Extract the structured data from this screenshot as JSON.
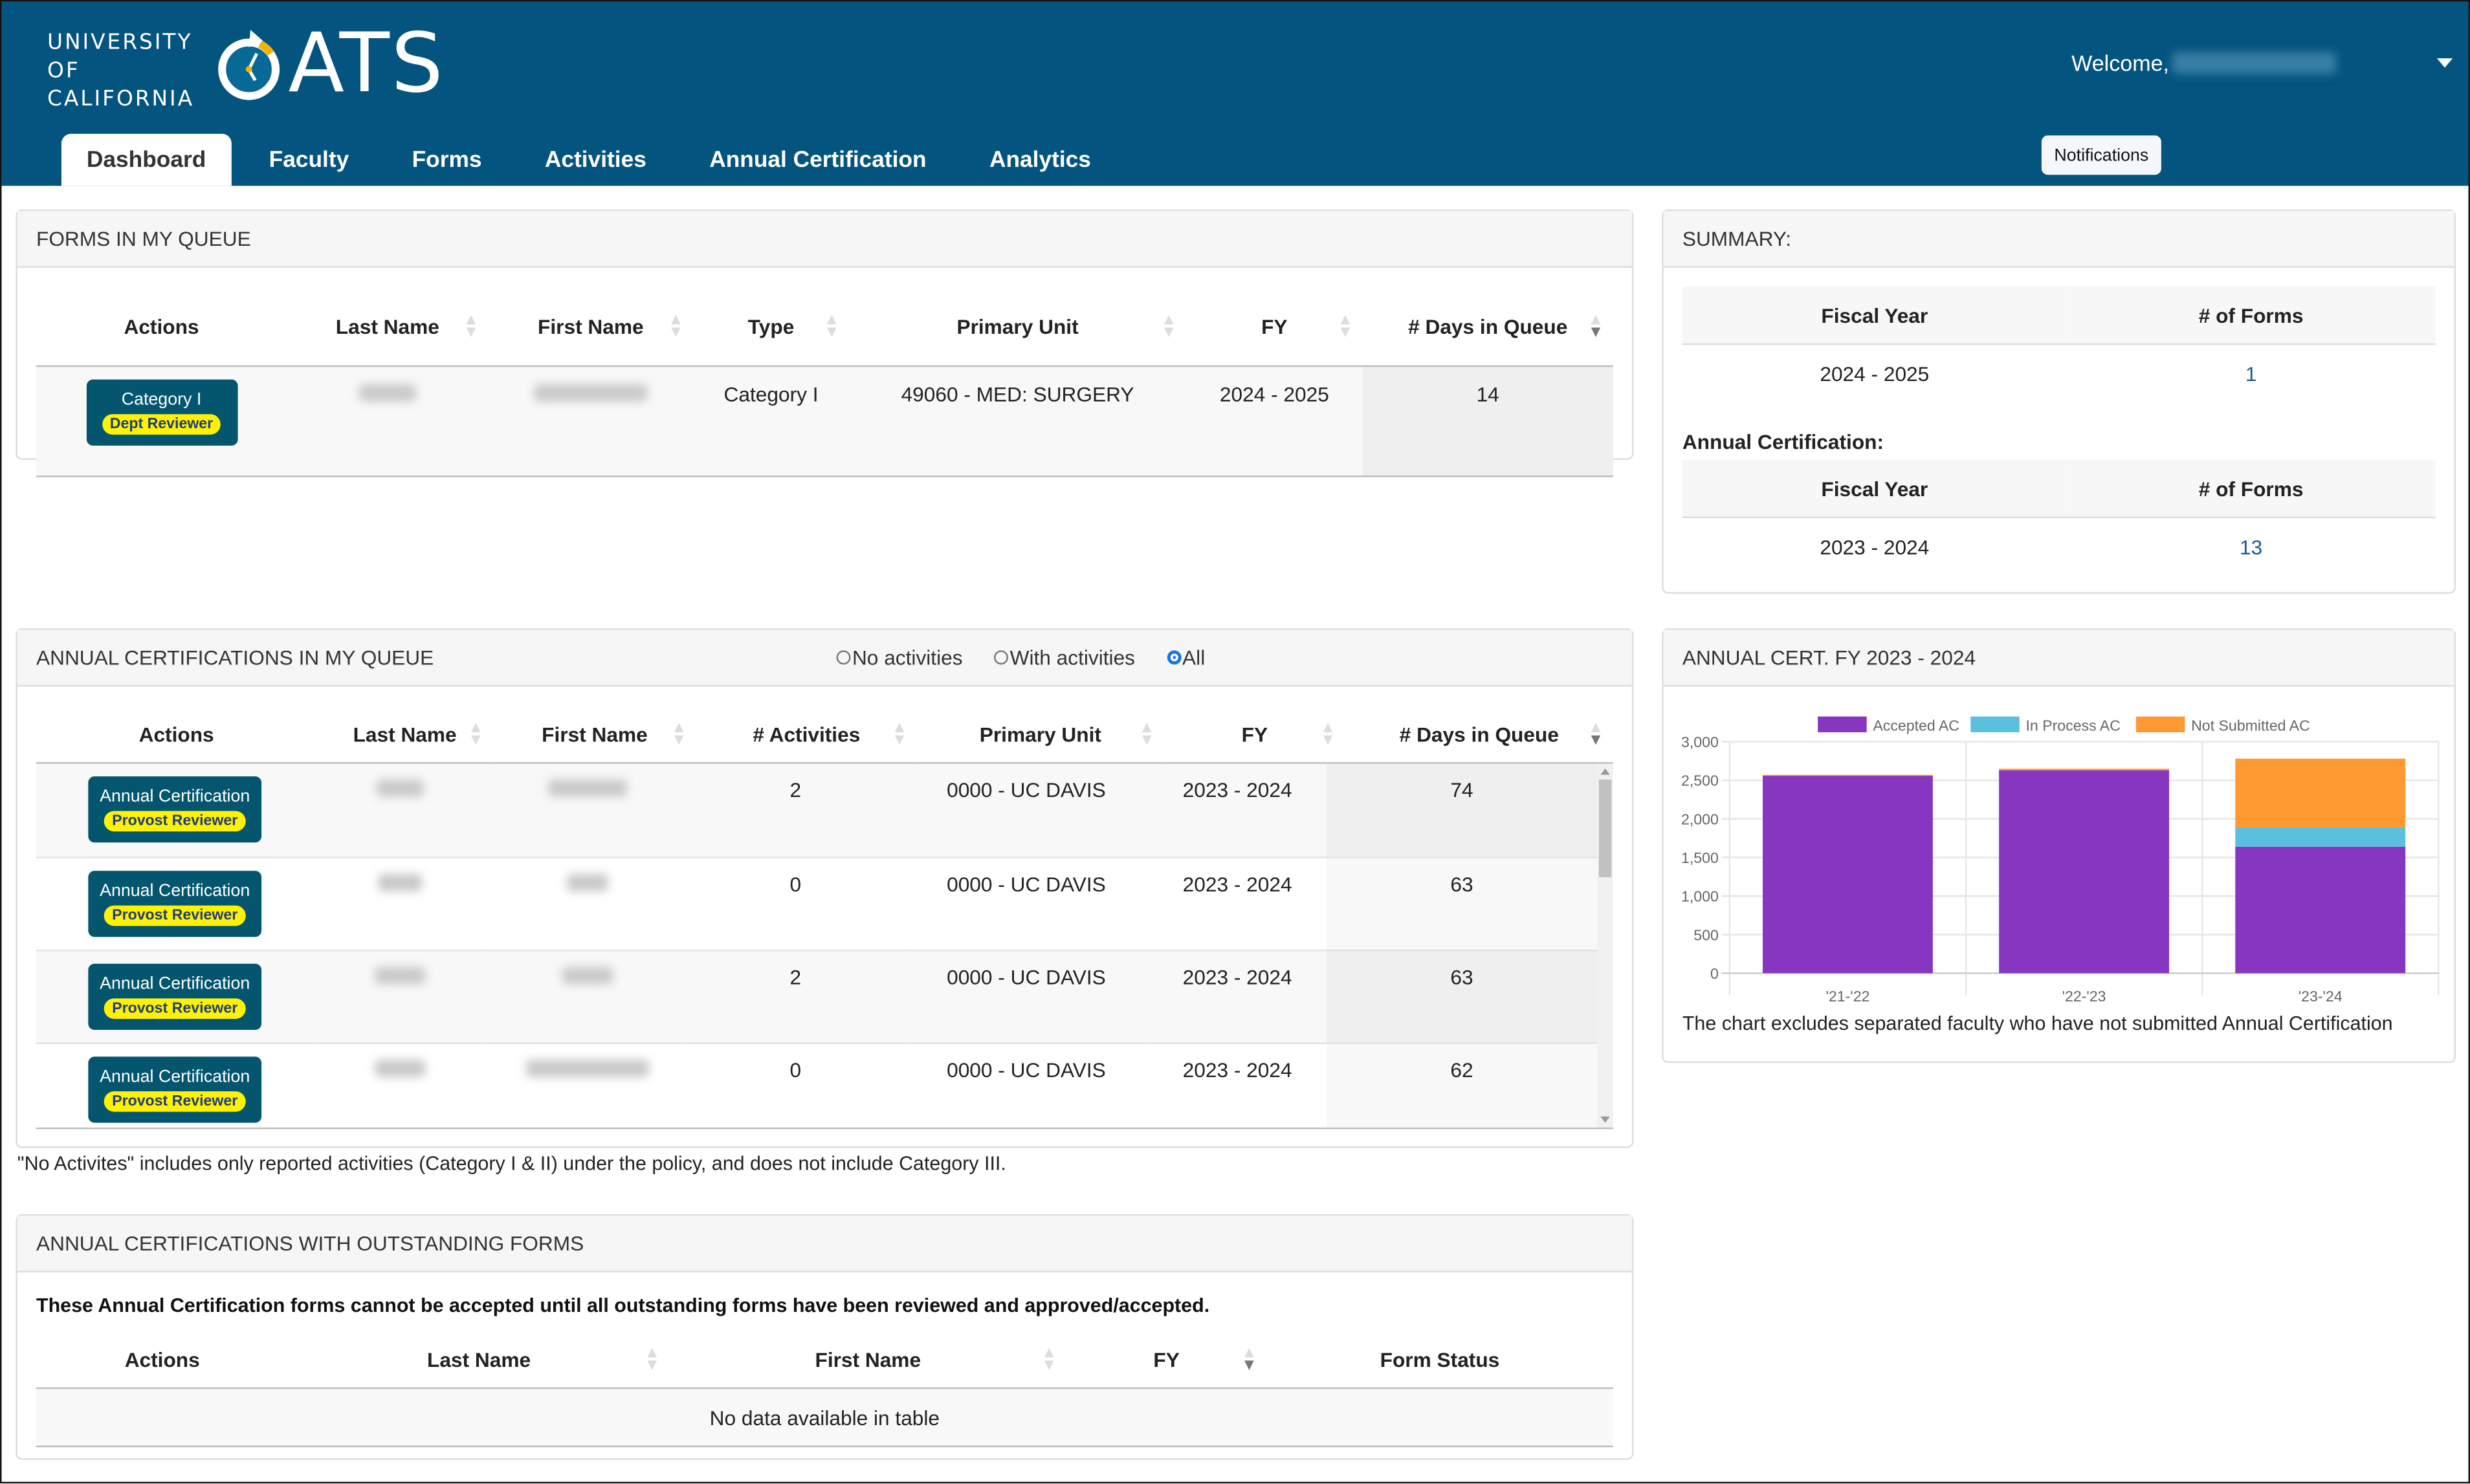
{
  "header": {
    "org_lines": [
      "UNIVERSITY",
      "OF",
      "CALIFORNIA"
    ],
    "app_name": "ATS",
    "app_logo_icon": "clock-o-icon",
    "welcome_label": "Welcome,",
    "user_menu_icon": "caret-down-icon",
    "notifications_label": "Notifications",
    "tabs": [
      {
        "label": "Dashboard",
        "active": true
      },
      {
        "label": "Faculty",
        "active": false
      },
      {
        "label": "Forms",
        "active": false
      },
      {
        "label": "Activities",
        "active": false
      },
      {
        "label": "Annual Certification",
        "active": false
      },
      {
        "label": "Analytics",
        "active": false
      }
    ]
  },
  "forms_queue": {
    "title": "FORMS IN MY QUEUE",
    "columns": [
      "Actions",
      "Last Name",
      "First Name",
      "Type",
      "Primary Unit",
      "FY",
      "# Days in Queue"
    ],
    "rows": [
      {
        "action_label": "Category I",
        "action_badge": "Dept Reviewer",
        "last_name": "[redacted]",
        "first_name": "[redacted]",
        "type": "Category I",
        "primary_unit": "49060 - MED: SURGERY",
        "fy": "2024 - 2025",
        "days": "14"
      }
    ]
  },
  "summary": {
    "title": "SUMMARY:",
    "forms_table": {
      "columns": [
        "Fiscal Year",
        "# of Forms"
      ],
      "rows": [
        {
          "fy": "2024 - 2025",
          "count": "1"
        }
      ]
    },
    "ac_label": "Annual Certification:",
    "ac_table": {
      "columns": [
        "Fiscal Year",
        "# of Forms"
      ],
      "rows": [
        {
          "fy": "2023 - 2024",
          "count": "13"
        }
      ]
    }
  },
  "ac_queue": {
    "title": "ANNUAL CERTIFICATIONS IN MY QUEUE",
    "filters": [
      {
        "label": "No activities",
        "checked": false
      },
      {
        "label": "With activities",
        "checked": false
      },
      {
        "label": "All",
        "checked": true
      }
    ],
    "columns": [
      "Actions",
      "Last Name",
      "First Name",
      "# Activities",
      "Primary Unit",
      "FY",
      "# Days in Queue"
    ],
    "rows": [
      {
        "action_label": "Annual Certification",
        "action_badge": "Provost Reviewer",
        "last_name": "[redacted]",
        "first_name": "[redacted]",
        "activities": "2",
        "primary_unit": "0000 - UC DAVIS",
        "fy": "2023 - 2024",
        "days": "74"
      },
      {
        "action_label": "Annual Certification",
        "action_badge": "Provost Reviewer",
        "last_name": "[redacted]",
        "first_name": "[redacted]",
        "activities": "0",
        "primary_unit": "0000 - UC DAVIS",
        "fy": "2023 - 2024",
        "days": "63"
      },
      {
        "action_label": "Annual Certification",
        "action_badge": "Provost Reviewer",
        "last_name": "[redacted]",
        "first_name": "[redacted]",
        "activities": "2",
        "primary_unit": "0000 - UC DAVIS",
        "fy": "2023 - 2024",
        "days": "63"
      },
      {
        "action_label": "Annual Certification",
        "action_badge": "Provost Reviewer",
        "last_name": "[redacted]",
        "first_name": "[redacted]",
        "activities": "0",
        "primary_unit": "0000 - UC DAVIS",
        "fy": "2023 - 2024",
        "days": "62"
      }
    ],
    "footnote": "\"No Activites\" includes only reported activities (Category I & II) under the policy, and does not include Category III."
  },
  "outstanding": {
    "title": "ANNUAL CERTIFICATIONS WITH OUTSTANDING FORMS",
    "description": "These Annual Certification forms cannot be accepted until all outstanding forms have been reviewed and approved/accepted.",
    "columns": [
      "Actions",
      "Last Name",
      "First Name",
      "FY",
      "Form Status"
    ],
    "empty_message": "No data available in table"
  },
  "chart_panel": {
    "title": "ANNUAL CERT. FY 2023 - 2024",
    "note": "The chart excludes separated faculty who have not submitted Annual Certification"
  },
  "chart_data": {
    "type": "bar",
    "stacked": true,
    "title": "",
    "xlabel": "",
    "ylabel": "",
    "categories": [
      "'21-'22",
      "'22-'23",
      "'23-'24"
    ],
    "series": [
      {
        "name": "Accepted AC",
        "color": "#8736c2",
        "values": [
          2560,
          2630,
          1640
        ]
      },
      {
        "name": "In Process AC",
        "color": "#5bc0de",
        "values": [
          0,
          0,
          250
        ]
      },
      {
        "name": "Not Submitted AC",
        "color": "#ff9a33",
        "values": [
          10,
          20,
          890
        ]
      }
    ],
    "ylim": [
      0,
      3000
    ],
    "yticks": [
      "0",
      "500",
      "1,000",
      "1,500",
      "2,000",
      "2,500",
      "3,000"
    ],
    "ytick_values": [
      0,
      500,
      1000,
      1500,
      2000,
      2500,
      3000
    ],
    "grid": true,
    "legend": "top-center"
  },
  "colors": {
    "header_bg": "#03547f",
    "action_button": "#04566f",
    "badge": "#fff200",
    "link": "#1a5a99"
  }
}
